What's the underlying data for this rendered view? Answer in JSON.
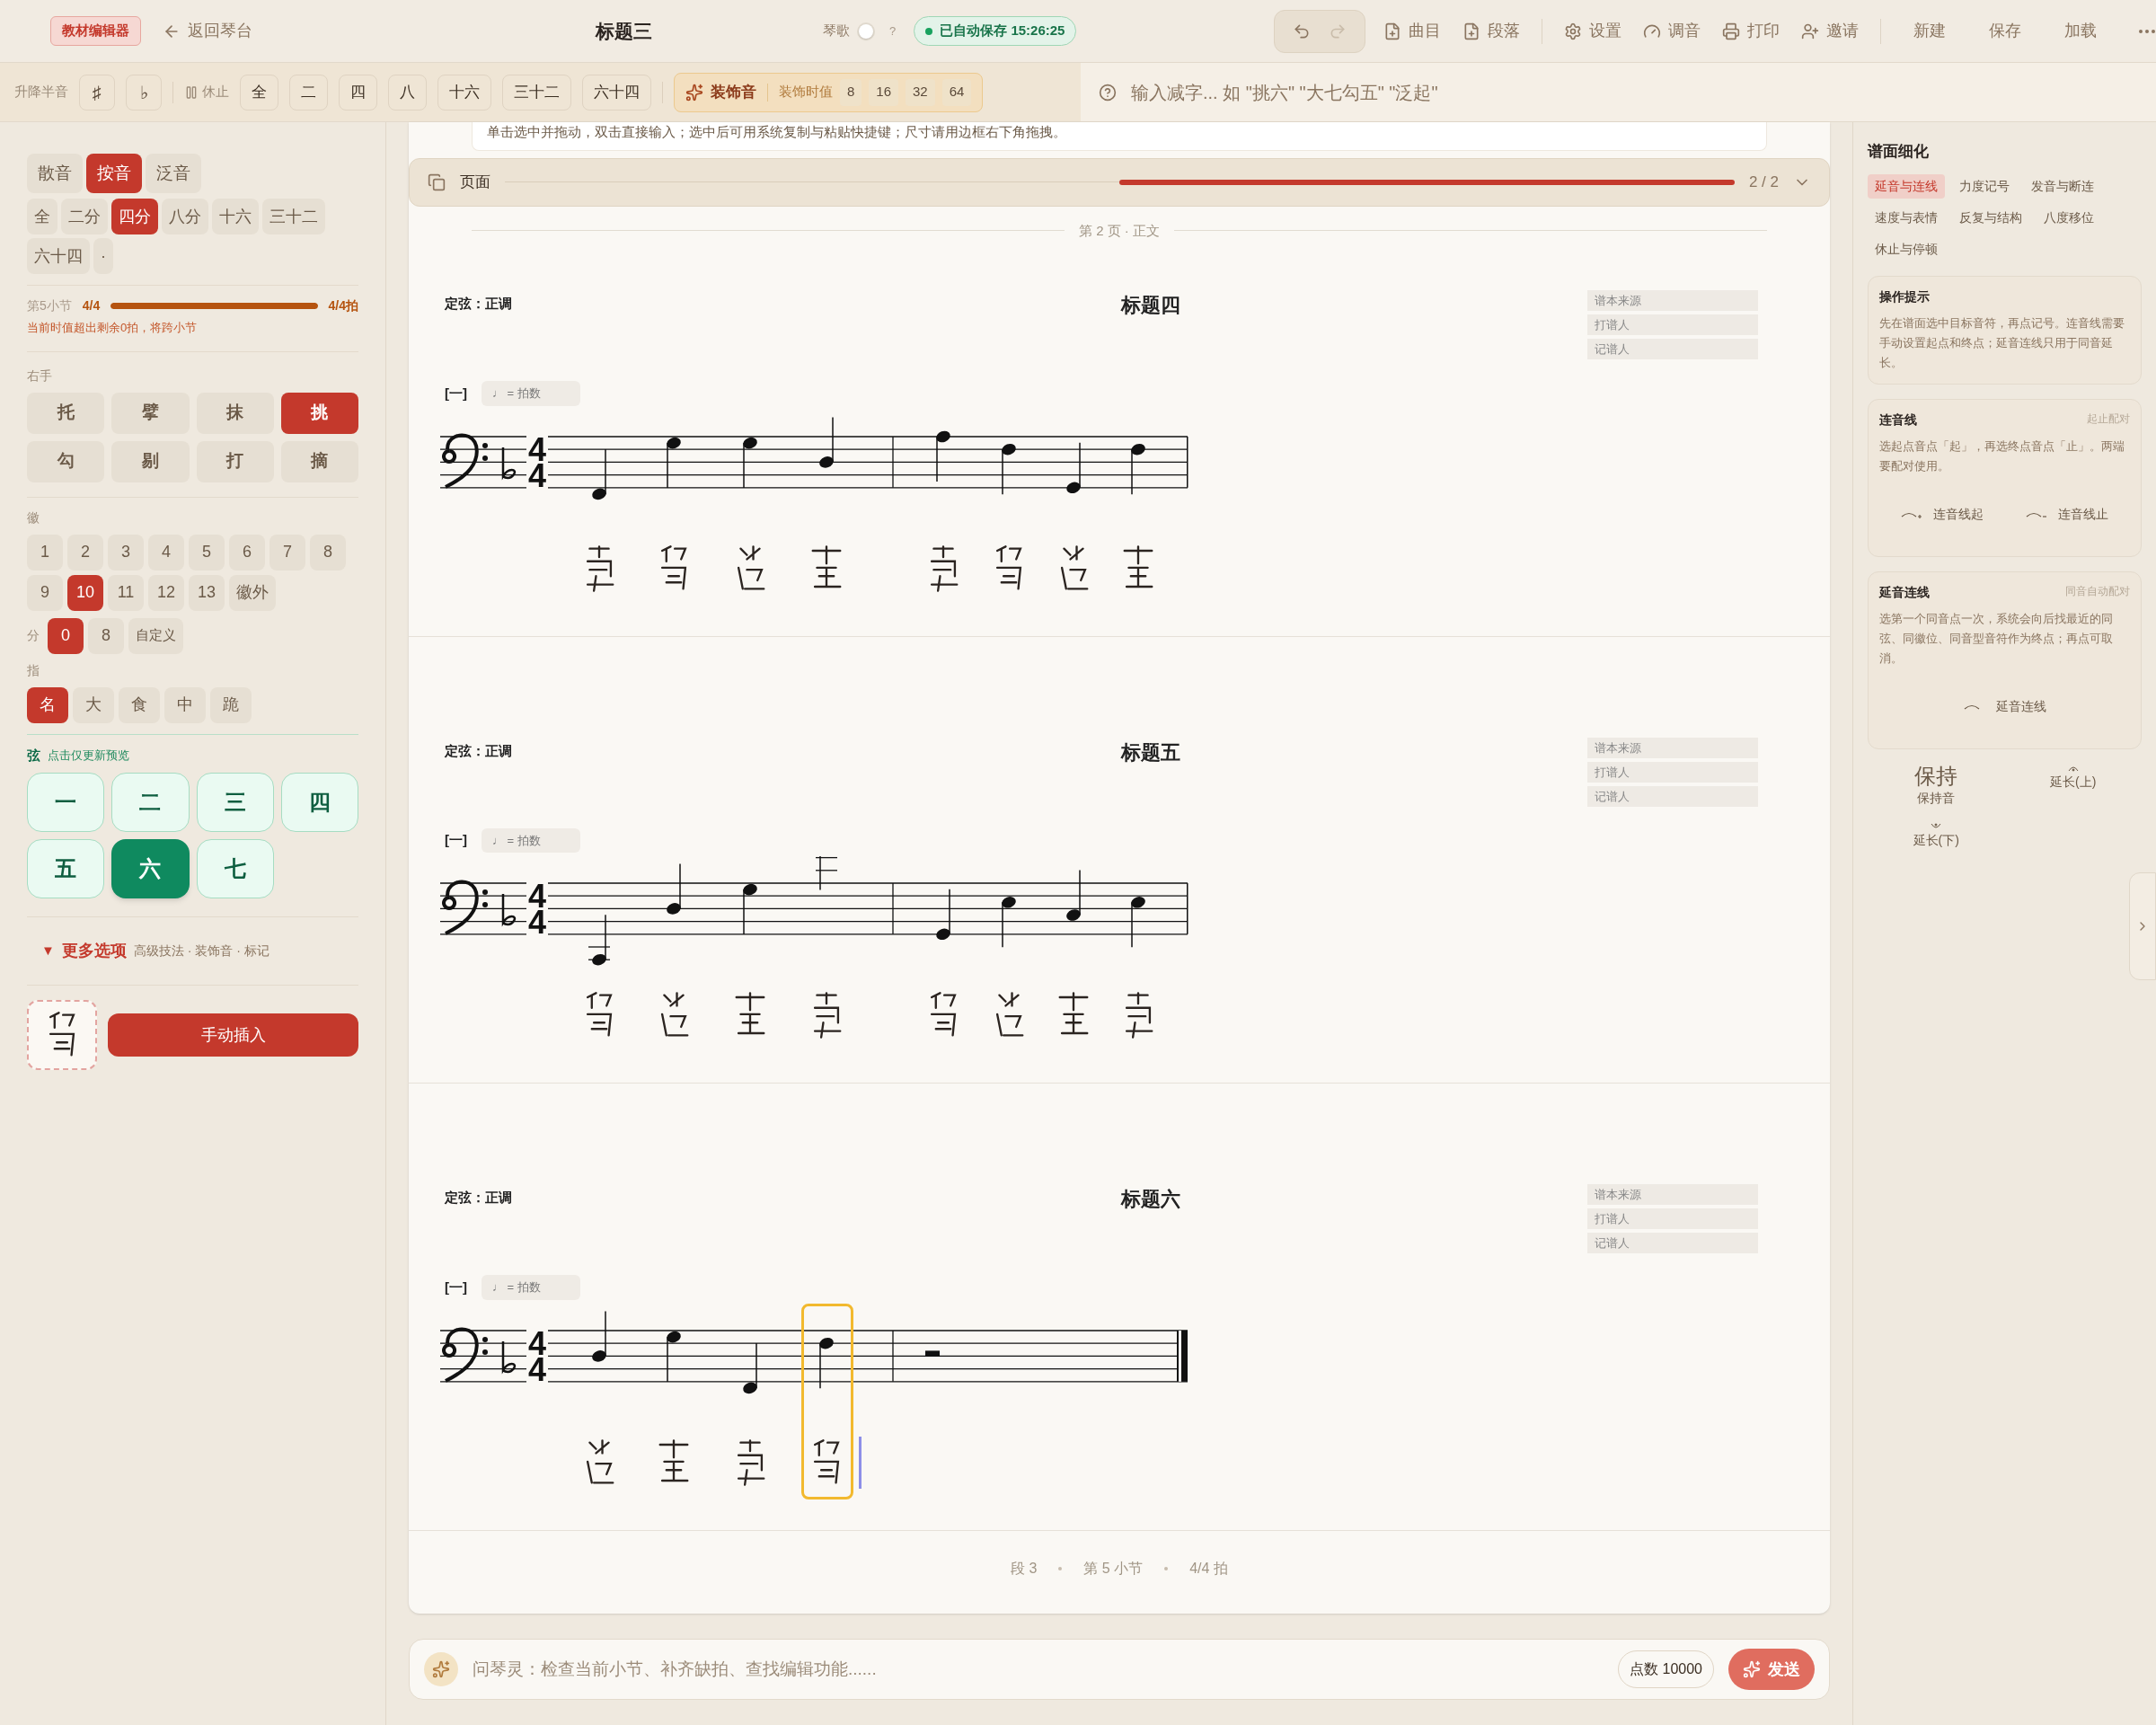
{
  "topbar": {
    "badge": "教材编辑器",
    "back": "返回琴台",
    "title": "标题三",
    "qinge": {
      "label": "琴歌",
      "on": false
    },
    "help": "?",
    "autosave": "已自动保存 15:26:25",
    "history": [
      {
        "kind": "undo",
        "disabled": false
      },
      {
        "kind": "redo",
        "disabled": true
      }
    ],
    "actions": [
      {
        "kind": "file",
        "label": "曲目"
      },
      {
        "kind": "file",
        "label": "段落"
      },
      {
        "kind": "gear",
        "label": "设置"
      },
      {
        "kind": "gauge",
        "label": "调音"
      },
      {
        "kind": "printer",
        "label": "打印"
      },
      {
        "kind": "invite",
        "label": "邀请"
      }
    ],
    "text_actions": [
      "新建",
      "保存",
      "加载"
    ]
  },
  "toolbar": {
    "accidental_label": "升降半音",
    "accidentals": [
      "♯",
      "♭"
    ],
    "rest_label": "休止",
    "rests": [
      "全",
      "二",
      "四",
      "八",
      "十六",
      "三十二",
      "六十四"
    ],
    "ornament": "装饰音",
    "ornament_duration_label": "装饰时值",
    "ornament_durations": [
      "8",
      "16",
      "32",
      "64"
    ]
  },
  "input": {
    "placeholder": "输入减字... 如 \"挑六\" \"大七勾五\" \"泛起\""
  },
  "left": {
    "sound_types": [
      {
        "label": "散音",
        "selected": false
      },
      {
        "label": "按音",
        "selected": true
      },
      {
        "label": "泛音",
        "selected": false
      }
    ],
    "durations": [
      {
        "label": "全",
        "selected": false
      },
      {
        "label": "二分",
        "selected": false
      },
      {
        "label": "四分",
        "selected": true
      },
      {
        "label": "八分",
        "selected": false
      },
      {
        "label": "十六",
        "selected": false
      },
      {
        "label": "三十二",
        "selected": false
      },
      {
        "label": "六十四",
        "selected": false
      },
      {
        "label": "·",
        "selected": false
      }
    ],
    "measure": {
      "label": "第5小节",
      "signature": "4/4",
      "level": 1,
      "reading": "4/4拍",
      "warning": "当前时值超出剩余0拍，将跨小节"
    },
    "right_hand": {
      "label": "右手",
      "items": [
        {
          "label": "托",
          "selected": false
        },
        {
          "label": "擘",
          "selected": false
        },
        {
          "label": "抹",
          "selected": false
        },
        {
          "label": "挑",
          "selected": true
        },
        {
          "label": "勾",
          "selected": false
        },
        {
          "label": "剔",
          "selected": false
        },
        {
          "label": "打",
          "selected": false
        },
        {
          "label": "摘",
          "selected": false
        }
      ]
    },
    "hui": {
      "label": "徽",
      "items": [
        {
          "label": "1",
          "selected": false
        },
        {
          "label": "2",
          "selected": false
        },
        {
          "label": "3",
          "selected": false
        },
        {
          "label": "4",
          "selected": false
        },
        {
          "label": "5",
          "selected": false
        },
        {
          "label": "6",
          "selected": false
        },
        {
          "label": "7",
          "selected": false
        },
        {
          "label": "8",
          "selected": false
        },
        {
          "label": "9",
          "selected": false
        },
        {
          "label": "10",
          "selected": true
        },
        {
          "label": "11",
          "selected": false
        },
        {
          "label": "12",
          "selected": false
        },
        {
          "label": "13",
          "selected": false
        },
        {
          "label": "徽外",
          "selected": false
        }
      ]
    },
    "fen": {
      "label": "分",
      "items": [
        {
          "label": "0",
          "selected": true
        },
        {
          "label": "8",
          "selected": false
        },
        {
          "label": "自定义",
          "selected": false
        }
      ]
    },
    "finger": {
      "label": "指",
      "items": [
        {
          "label": "名",
          "selected": true
        },
        {
          "label": "大",
          "selected": false
        },
        {
          "label": "食",
          "selected": false
        },
        {
          "label": "中",
          "selected": false
        },
        {
          "label": "跪",
          "selected": false
        }
      ]
    },
    "strings": {
      "label": "弦",
      "hint": "点击仅更新预览",
      "items": [
        {
          "label": "一",
          "selected": false
        },
        {
          "label": "二",
          "selected": false
        },
        {
          "label": "三",
          "selected": false
        },
        {
          "label": "四",
          "selected": false
        },
        {
          "label": "五",
          "selected": false
        },
        {
          "label": "六",
          "selected": true
        },
        {
          "label": "七",
          "selected": false
        }
      ]
    },
    "more": {
      "marker": "▼",
      "label": "更多选项",
      "hint": "高级技法 · 装饰音 · 标记"
    },
    "insert": "手动插入"
  },
  "center": {
    "hint": "单击选中并拖动，双击直接输入；选中后可用系统复制与粘贴快捷键；尺寸请用边框右下角拖拽。",
    "pages": {
      "label": "页面",
      "count": "2 / 2"
    },
    "page_divider": "第 2 页 · 正文",
    "systems": [
      {
        "tuning": "定弦：正调",
        "title": "标题四",
        "meta": [
          "谱本来源",
          "打谱人",
          "记谱人"
        ],
        "section": "[一]",
        "tempo": "♩ = 拍数",
        "time_signature": [
          "4",
          "4"
        ],
        "final": false
      },
      {
        "tuning": "定弦：正调",
        "title": "标题五",
        "meta": [
          "谱本来源",
          "打谱人",
          "记谱人"
        ],
        "section": "[一]",
        "tempo": "♩ = 拍数",
        "time_signature": [
          "4",
          "4"
        ],
        "final": false
      },
      {
        "tuning": "定弦：正调",
        "title": "标题六",
        "meta": [
          "谱本来源",
          "打谱人",
          "记谱人"
        ],
        "section": "[一]",
        "tempo": "♩ = 拍数",
        "time_signature": [
          "4",
          "4"
        ],
        "final": true
      }
    ],
    "status": [
      "段 3",
      "第 5 小节",
      "4/4 拍"
    ]
  },
  "chat": {
    "placeholder": "问琴灵：检查当前小节、补齐缺拍、查找编辑功能......",
    "points": "点数 10000",
    "send": "发送"
  },
  "right": {
    "title": "谱面细化",
    "tabs": [
      {
        "label": "延音与连线",
        "selected": true
      },
      {
        "label": "力度记号",
        "selected": false
      },
      {
        "label": "发音与断连",
        "selected": false
      },
      {
        "label": "速度与表情",
        "selected": false
      },
      {
        "label": "反复与结构",
        "selected": false
      },
      {
        "label": "八度移位",
        "selected": false
      },
      {
        "label": "休止与停顿",
        "selected": false
      }
    ],
    "cards": [
      {
        "title": "操作提示",
        "text": "先在谱面选中目标音符，再点记号。连音线需要手动设置起点和终点；延音连线只用于同音延长。"
      },
      {
        "title": "连音线",
        "tag": "起止配对",
        "text": "选起点音点「起」，再选终点音点「止」。两端要配对使用。",
        "buttons": [
          {
            "kind": "slur-start",
            "label": "连音线起"
          },
          {
            "kind": "slur-end",
            "label": "连音线止"
          }
        ]
      },
      {
        "title": "延音连线",
        "tag": "同音自动配对",
        "text": "选第一个同音点一次，系统会向后找最近的同弦、同徽位、同音型音符作为终点；再点可取消。",
        "buttons": [
          {
            "kind": "tie",
            "label": "延音连线"
          }
        ]
      }
    ],
    "symbols": [
      {
        "kind": "text",
        "glyph": "保持",
        "label": "保持音"
      },
      {
        "kind": "fermata-up",
        "label": "延长(上)"
      },
      {
        "kind": "fermata-down",
        "label": "延长(下)"
      }
    ]
  }
}
